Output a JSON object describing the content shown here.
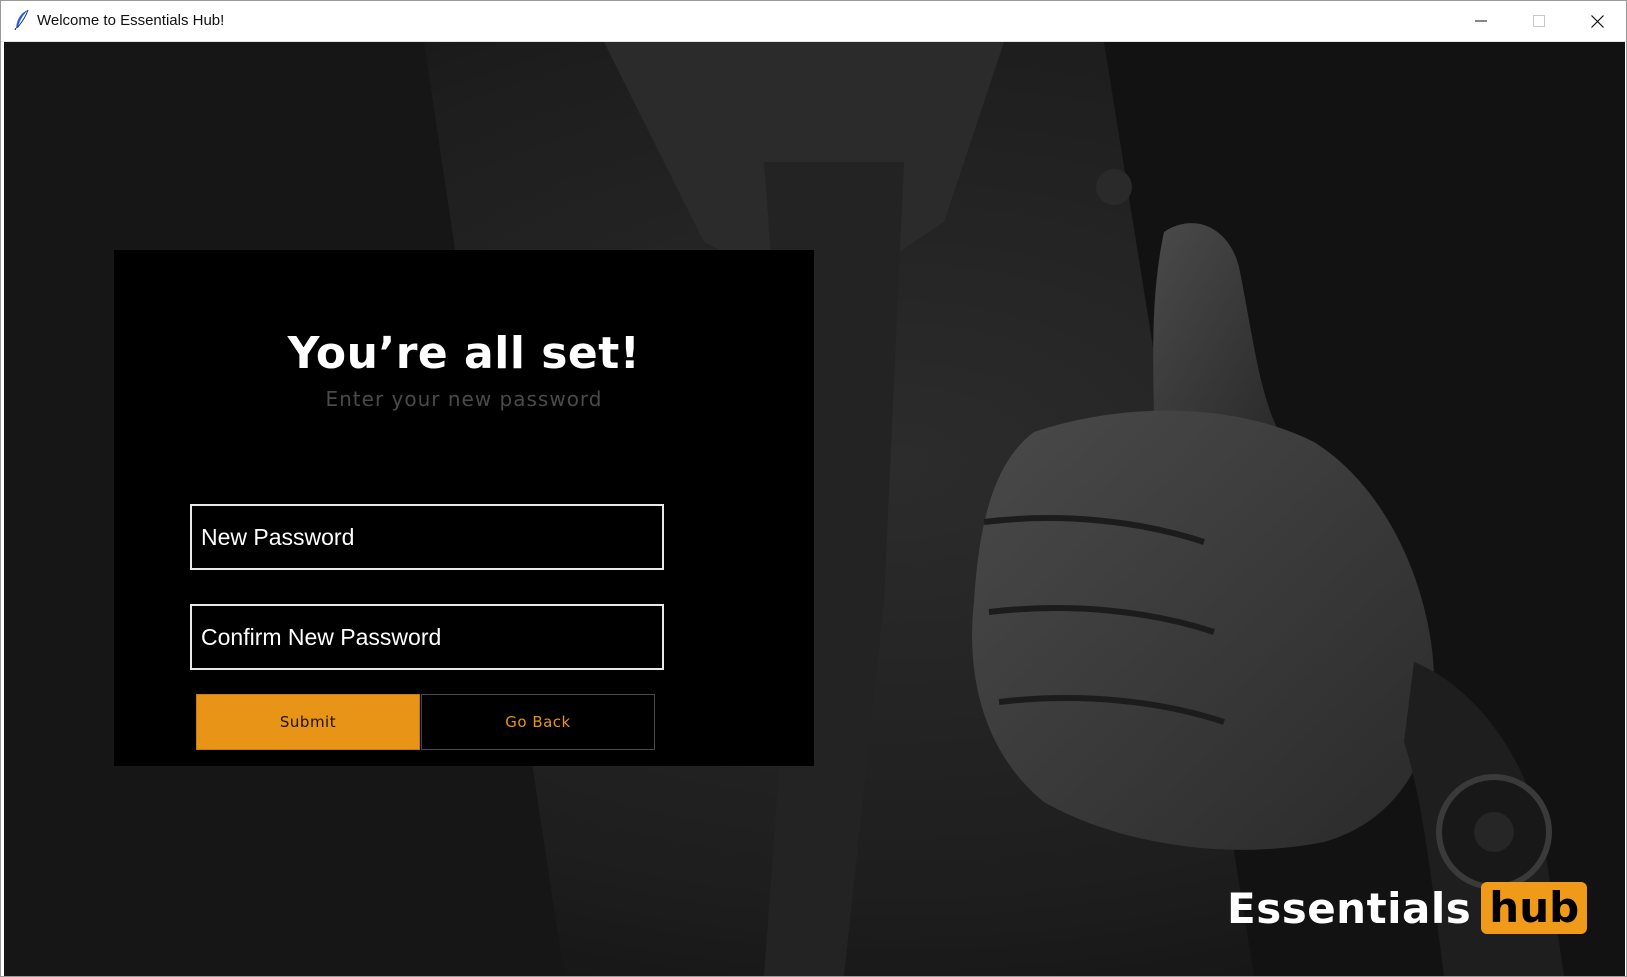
{
  "window": {
    "title": "Welcome to Essentials Hub!",
    "icon": "feather-icon",
    "controls": [
      "minimize-icon",
      "maximize-icon",
      "close-icon"
    ]
  },
  "dialog": {
    "heading": "You’re all set!",
    "subheading": "Enter your new password",
    "new_password": {
      "placeholder": "New Password",
      "value": ""
    },
    "confirm_password": {
      "placeholder": "Confirm New Password",
      "value": ""
    },
    "submit_label": "Submit",
    "back_label": "Go Back"
  },
  "brand": {
    "word": "Essentials",
    "badge": "hub"
  },
  "colors": {
    "accent": "#e89417",
    "panel": "#000000",
    "text": "#ffffff",
    "subtle_text": "#4a4a4a"
  }
}
